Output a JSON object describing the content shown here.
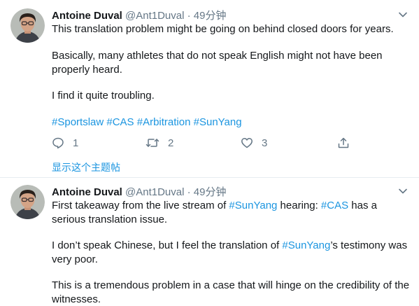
{
  "tweets": [
    {
      "author": {
        "name": "Antoine Duval",
        "handle": "@Ant1Duval"
      },
      "separator": "·",
      "time": "49分钟",
      "paragraphs": [
        [
          {
            "text": "This translation problem might be going on behind closed doors for years."
          }
        ],
        [
          {
            "text": "Basically, many athletes that do not speak English might not have been properly heard."
          }
        ],
        [
          {
            "text": "I find it quite troubling."
          }
        ],
        [
          {
            "text": "#Sportslaw",
            "tag": true
          },
          {
            "text": " "
          },
          {
            "text": "#CAS",
            "tag": true
          },
          {
            "text": " "
          },
          {
            "text": "#Arbitration",
            "tag": true
          },
          {
            "text": " "
          },
          {
            "text": "#SunYang",
            "tag": true
          }
        ]
      ],
      "actions": {
        "reply_count": "1",
        "retweet_count": "2",
        "like_count": "3"
      },
      "show_thread": "显示这个主题帖"
    },
    {
      "author": {
        "name": "Antoine Duval",
        "handle": "@Ant1Duval"
      },
      "separator": "·",
      "time": "49分钟",
      "paragraphs": [
        [
          {
            "text": "First takeaway from the live stream of "
          },
          {
            "text": "#SunYang",
            "tag": true
          },
          {
            "text": " hearing: "
          },
          {
            "text": "#CAS",
            "tag": true
          },
          {
            "text": " has a serious translation issue."
          }
        ],
        [
          {
            "text": "I don’t speak Chinese, but I feel the translation of "
          },
          {
            "text": "#SunYang",
            "tag": true
          },
          {
            "text": "’s testimony was very poor."
          }
        ],
        [
          {
            "text": "This is a tremendous problem in a case that will hinge on the credibility of the witnesses."
          }
        ]
      ]
    }
  ],
  "colors": {
    "link": "#1b95e0",
    "meta": "#657786",
    "text": "#14171a",
    "divider": "#e6ecf0"
  },
  "icons": [
    "avatar-photo",
    "chevron-down-icon",
    "reply-icon",
    "retweet-icon",
    "heart-icon",
    "share-icon"
  ]
}
